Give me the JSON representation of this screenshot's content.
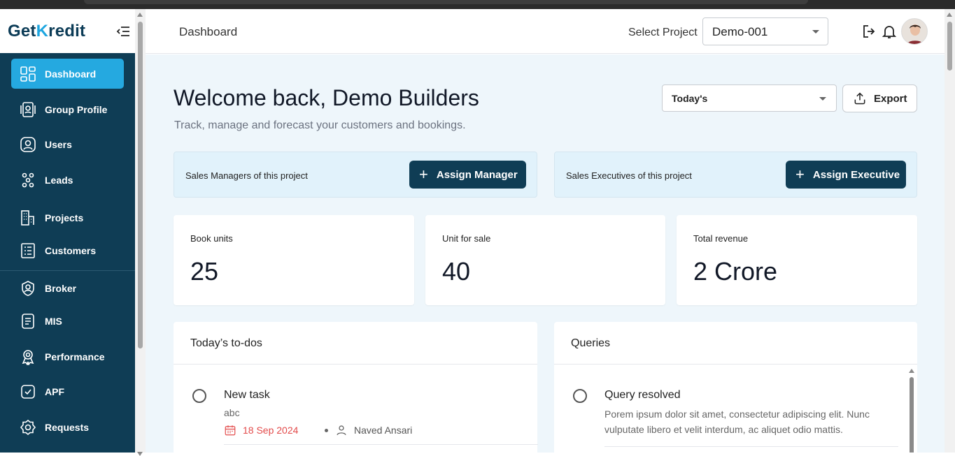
{
  "brand": {
    "prefix": "Get",
    "accent": "K",
    "suffix": "redit"
  },
  "sidebar": {
    "items": [
      {
        "label": "Dashboard"
      },
      {
        "label": "Group Profile"
      },
      {
        "label": "Users"
      },
      {
        "label": "Leads"
      },
      {
        "label": "Projects"
      },
      {
        "label": "Customers"
      },
      {
        "label": "Broker"
      },
      {
        "label": "MIS"
      },
      {
        "label": "Performance"
      },
      {
        "label": "APF"
      },
      {
        "label": "Requests"
      }
    ]
  },
  "header": {
    "title": "Dashboard",
    "select_label": "Select Project",
    "project_value": "Demo-001"
  },
  "main": {
    "welcome": "Welcome back, Demo Builders",
    "subtitle": "Track, manage and forecast your customers and bookings.",
    "range_value": "Today's",
    "export_label": "Export",
    "managers_label": "Sales Managers of this project",
    "assign_manager": "Assign Manager",
    "executives_label": "Sales Executives of this project",
    "assign_executive": "Assign Executive",
    "stats": [
      {
        "label": "Book units",
        "value": "25"
      },
      {
        "label": "Unit for sale",
        "value": "40"
      },
      {
        "label": "Total revenue",
        "value": "2 Crore"
      }
    ],
    "todos": {
      "title": "Today’s to-dos",
      "task": {
        "title": "New task",
        "sub": "abc",
        "date": "18 Sep 2024",
        "assignee": "Naved Ansari"
      }
    },
    "queries": {
      "title": "Queries",
      "item": {
        "title": "Query resolved",
        "body": "Porem ipsum dolor sit amet, consectetur adipiscing elit. Nunc vulputate libero et velit interdum, ac aliquet odio mattis."
      }
    }
  },
  "colors": {
    "sidebar": "#0f3d55",
    "accent": "#25a9e0",
    "background": "#eef6fb",
    "date": "#e34b4b"
  }
}
